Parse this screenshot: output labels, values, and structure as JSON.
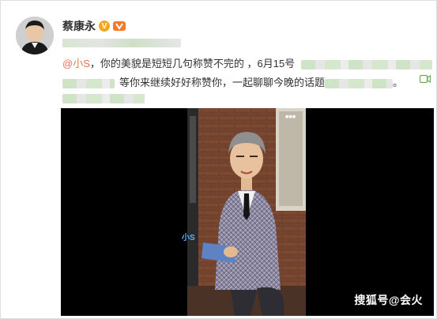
{
  "post": {
    "author": "蔡康永",
    "verified_badge": "V",
    "mention": "@小S",
    "line1_text": "，你的美貌是短短几句称赞不完的 ，6月15号",
    "line2_text": "等你来继续好好称赞你，一起聊聊今晚的话题",
    "line2_tail": "。"
  },
  "video": {
    "sticker_text": "小S",
    "watermark": "搜狐号@会火"
  },
  "icons": {
    "verified": "verified-v-icon",
    "level": "level-badge-icon",
    "video": "video-camera-icon"
  },
  "colors": {
    "mention": "#eb7350",
    "verified": "#f5a623",
    "blurred_text": "#cfe3c6"
  }
}
